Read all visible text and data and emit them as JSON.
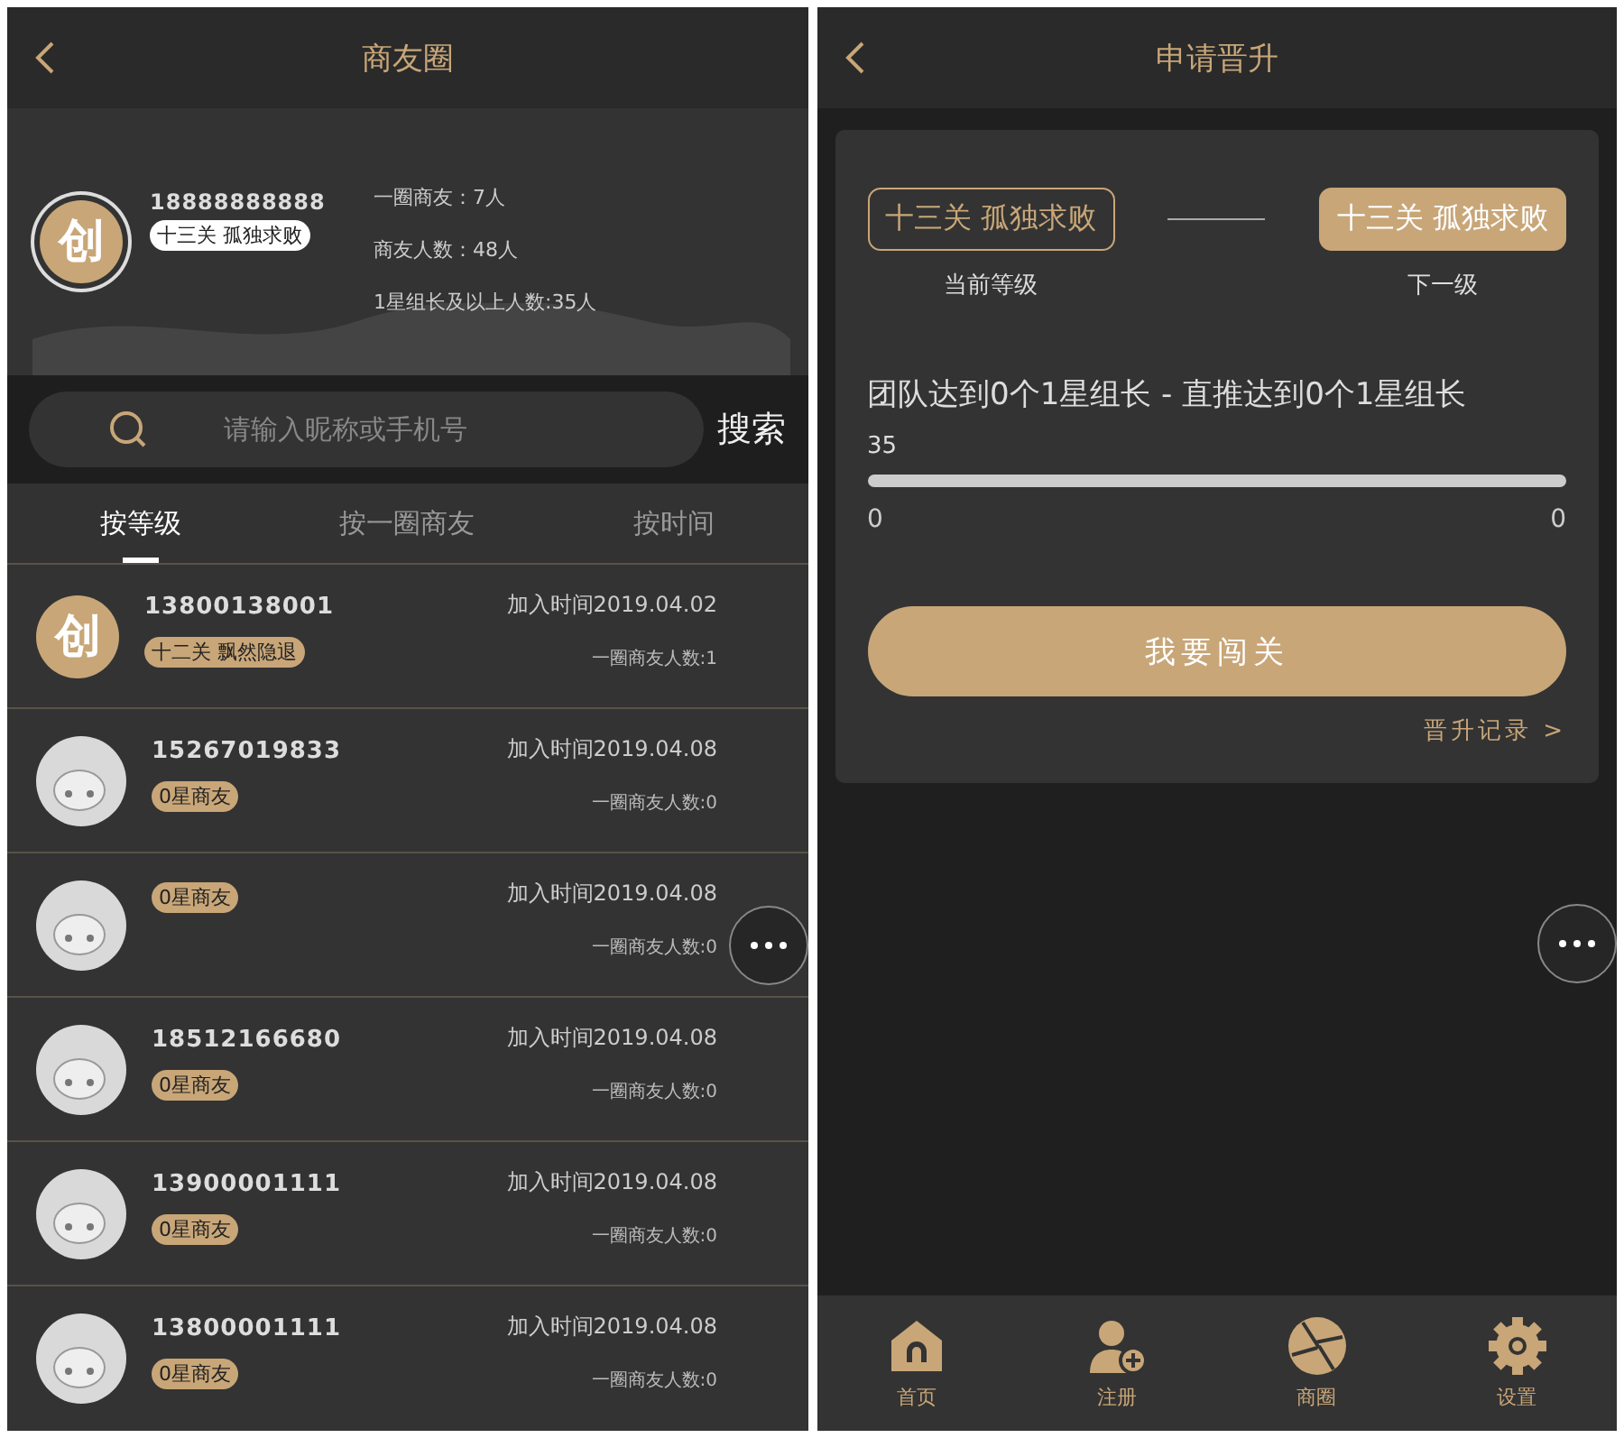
{
  "left_screen": {
    "title": "商友圈",
    "profile": {
      "avatar_glyph": "创",
      "phone": "18888888888",
      "level": "十三关 孤独求败",
      "stats": [
        "一圈商友：7人",
        "商友人数：48人",
        "1星组长及以上人数:35人"
      ]
    },
    "search": {
      "placeholder": "请输入昵称或手机号",
      "button": "搜索"
    },
    "tabs": [
      {
        "label": "按等级",
        "selected": true
      },
      {
        "label": "按一圈商友",
        "selected": false
      },
      {
        "label": "按时间",
        "selected": false
      }
    ],
    "members": [
      {
        "avatar": {
          "kind": "logo",
          "glyph": "创"
        },
        "phone": "13800138001",
        "level": "十二关 飘然隐退",
        "joined": "加入时间2019.04.02",
        "friends": "一圈商友人数:1"
      },
      {
        "avatar": {
          "kind": "cartoon"
        },
        "phone": "15267019833",
        "level": "0星商友",
        "joined": "加入时间2019.04.08",
        "friends": "一圈商友人数:0"
      },
      {
        "avatar": {
          "kind": "cartoon"
        },
        "level": "0星商友",
        "joined": "加入时间2019.04.08",
        "friends": "一圈商友人数:0"
      },
      {
        "avatar": {
          "kind": "cartoon"
        },
        "phone": "18512166680",
        "level": "0星商友",
        "joined": "加入时间2019.04.08",
        "friends": "一圈商友人数:0"
      },
      {
        "avatar": {
          "kind": "cartoon"
        },
        "phone": "13900001111",
        "level": "0星商友",
        "joined": "加入时间2019.04.08",
        "friends": "一圈商友人数:0"
      },
      {
        "avatar": {
          "kind": "cartoon"
        },
        "phone": "13800001111",
        "level": "0星商友",
        "joined": "加入时间2019.04.08",
        "friends": "一圈商友人数:0"
      }
    ]
  },
  "right_screen": {
    "title": "申请晋升",
    "current": {
      "level": "十三关 孤独求败",
      "caption": "当前等级"
    },
    "next": {
      "level": "十三关 孤独求败",
      "caption": "下一级"
    },
    "requirement": "团队达到0个1星组长 - 直推达到0个1星组长",
    "progress": {
      "marker": "35",
      "level": 0,
      "min": "0",
      "max": "0"
    },
    "action": "我要闯关",
    "history_link": "晋升记录 >",
    "nav": [
      {
        "label": "首页"
      },
      {
        "label": "注册"
      },
      {
        "label": "商圈"
      },
      {
        "label": "设置"
      }
    ]
  }
}
